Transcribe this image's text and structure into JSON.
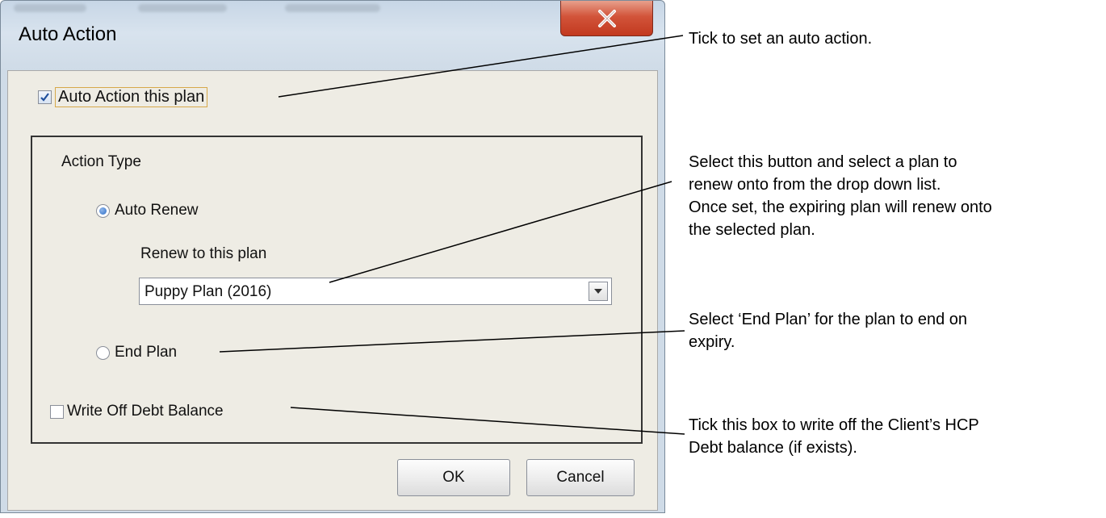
{
  "dialog": {
    "title": "Auto Action",
    "close_label": "X",
    "auto_action_checkbox": {
      "label": "Auto Action this plan",
      "checked": true
    },
    "action_type_heading": "Action Type",
    "auto_renew_radio": {
      "label": "Auto Renew",
      "selected": true
    },
    "renew_to_label": "Renew to this plan",
    "plan_select": {
      "value": "Puppy Plan (2016)"
    },
    "end_plan_radio": {
      "label": "End Plan",
      "selected": false
    },
    "write_off_checkbox": {
      "label": "Write Off Debt Balance",
      "checked": false
    },
    "ok_label": "OK",
    "cancel_label": "Cancel"
  },
  "annotations": {
    "tick_auto_action": "Tick to set an auto action.",
    "select_plan": [
      "Select this button and select a plan to",
      "renew onto from the drop down list.",
      "Once set, the expiring plan will renew onto",
      "the selected plan."
    ],
    "end_plan": [
      "Select ‘End Plan’ for the plan to end on",
      "expiry."
    ],
    "write_off": [
      "Tick this box to write off the Client’s HCP",
      "Debt balance (if exists)."
    ]
  },
  "colors": {
    "close_button": "#c2391f",
    "window_frame": "#cfdbe7",
    "client_area": "#eeece4",
    "focus_border": "#d6a84a"
  }
}
